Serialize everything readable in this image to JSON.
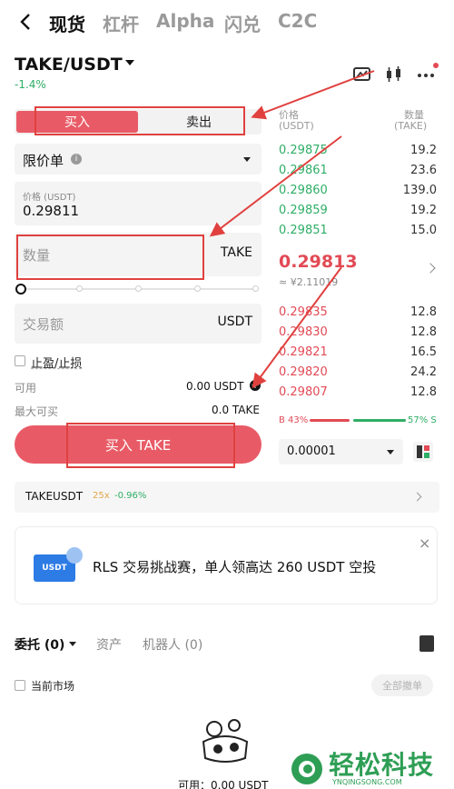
{
  "nav": {
    "tabs": [
      "现货",
      "杠杆",
      "Alpha",
      "闪兑",
      "C2C"
    ]
  },
  "pair": {
    "symbol": "TAKE/USDT",
    "change": "-1.4%"
  },
  "side": {
    "buy": "买入",
    "sell": "卖出"
  },
  "order_type": {
    "label": "限价单",
    "info": "i"
  },
  "price": {
    "label": "价格 (USDT)",
    "value": "0.29811"
  },
  "quantity": {
    "placeholder": "数量",
    "unit": "TAKE"
  },
  "amount": {
    "placeholder": "交易额",
    "unit": "USDT"
  },
  "tpsl": {
    "label": "止盈/止损"
  },
  "available": {
    "label": "可用",
    "value": "0.00 USDT"
  },
  "max_buy": {
    "label": "最大可买",
    "value": "0.0 TAKE"
  },
  "submit": {
    "label": "买入 TAKE"
  },
  "orderbook": {
    "price_header": "价格",
    "price_unit": "(USDT)",
    "qty_header": "数量",
    "qty_unit": "(TAKE)",
    "asks": [
      {
        "price": "0.29875",
        "qty": "19.2"
      },
      {
        "price": "0.29861",
        "qty": "23.6"
      },
      {
        "price": "0.29860",
        "qty": "139.0"
      },
      {
        "price": "0.29859",
        "qty": "19.2"
      },
      {
        "price": "0.29851",
        "qty": "15.0"
      }
    ],
    "mid_price": "0.29813",
    "mid_cny": "≈ ¥2.11019",
    "bids": [
      {
        "price": "0.29835",
        "qty": "12.8"
      },
      {
        "price": "0.29830",
        "qty": "12.8"
      },
      {
        "price": "0.29821",
        "qty": "16.5"
      },
      {
        "price": "0.29820",
        "qty": "24.2"
      },
      {
        "price": "0.29807",
        "qty": "12.8"
      }
    ],
    "buy_ratio": "B 43%",
    "sell_ratio": "57% S",
    "buy_fraction": 0.43,
    "precision": "0.00001"
  },
  "ticker": {
    "symbol": "TAKEUSDT",
    "leverage": "25x",
    "change": "-0.96%"
  },
  "banner": {
    "card": "USDT",
    "text": "RLS 交易挑战赛，单人领高达 260 USDT 空投",
    "close": "×"
  },
  "bottom_tabs": {
    "orders": "委托 (0)",
    "assets": "资产",
    "bots": "机器人 (0)"
  },
  "current_market": "当前市场",
  "cancel_all": "全部撤单",
  "bottom_available": "可用：0.00 USDT",
  "watermark": {
    "text": "轻松科技",
    "sub": "YNQINGSONG.COM"
  },
  "colors": {
    "buy": "#e85b66",
    "down": "#e24a55",
    "up": "#2fae66",
    "annotation": "#e0413f"
  }
}
